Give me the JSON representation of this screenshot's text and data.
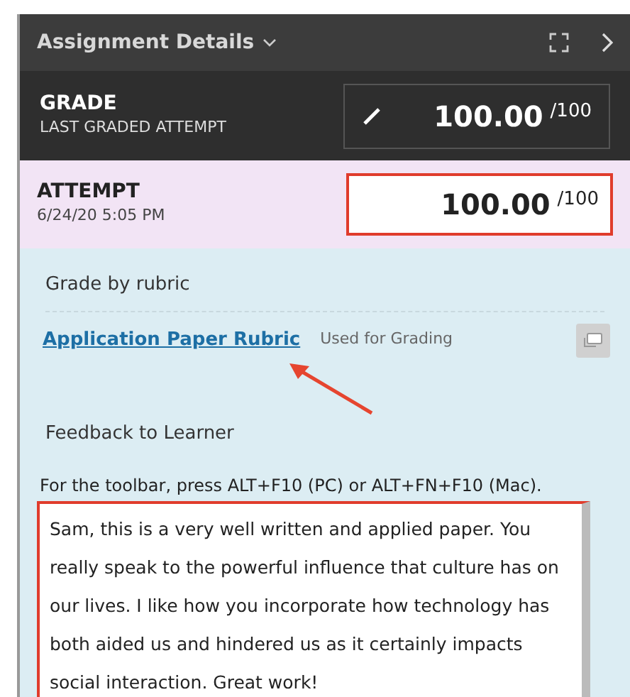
{
  "header": {
    "title": "Assignment Details"
  },
  "grade": {
    "label": "GRADE",
    "sublabel": "LAST GRADED ATTEMPT",
    "value": "100.00",
    "out_of": "/100"
  },
  "attempt": {
    "label": "ATTEMPT",
    "date": "6/24/20 5:05 PM",
    "value": "100.00",
    "out_of": "/100"
  },
  "rubric": {
    "section_label": "Grade by rubric",
    "link": "Application Paper Rubric",
    "status": "Used for Grading"
  },
  "feedback": {
    "label": "Feedback to Learner",
    "hint": "For the toolbar, press ALT+F10 (PC) or ALT+FN+F10 (Mac).",
    "text": "Sam, this is a very well written and applied paper. You really speak to the powerful influence that culture has on our lives. I like how you incorporate how technology has both aided us and hindered us as it certainly impacts social interaction. Great work!"
  }
}
